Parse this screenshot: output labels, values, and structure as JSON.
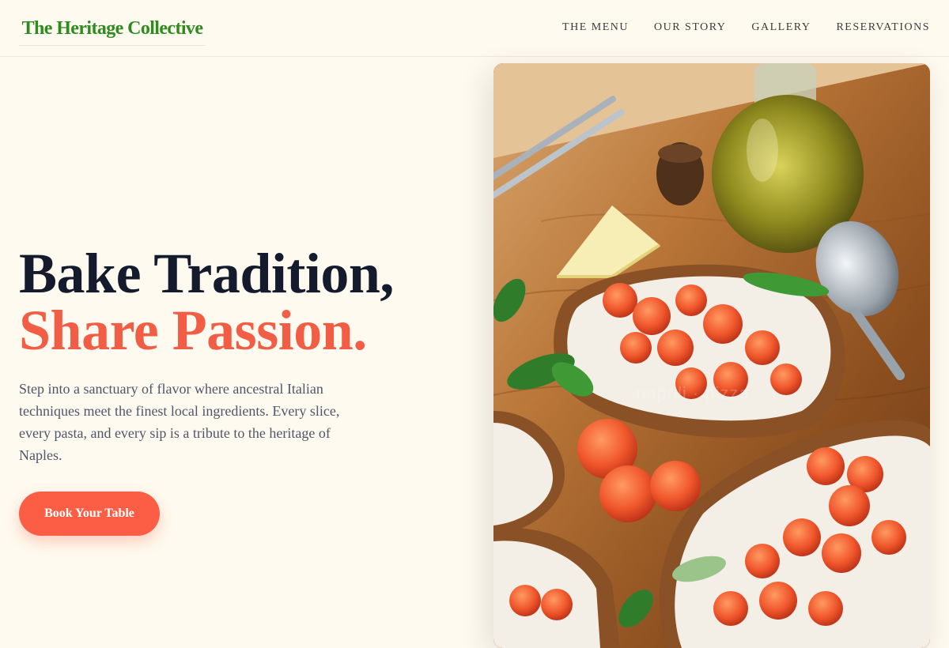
{
  "brand": {
    "name": "The Heritage Collective"
  },
  "nav": {
    "items": [
      {
        "label": "THE MENU"
      },
      {
        "label": "OUR STORY"
      },
      {
        "label": "GALLERY"
      },
      {
        "label": "RESERVATIONS"
      }
    ]
  },
  "hero": {
    "headline_line1": "Bake Tradition,",
    "headline_line2": "Share Passion.",
    "description": "Step into a sanctuary of flavor where ancestral Italian techniques meet the finest local ingredients. Every slice, every pasta, and every sip is a tribute to the heritage of Naples.",
    "cta_label": "Book Your Table"
  },
  "colors": {
    "background": "#fefaef",
    "brand_green": "#2f8a1f",
    "accent_coral": "#fb5d45",
    "headline_dark": "#141b2d"
  }
}
